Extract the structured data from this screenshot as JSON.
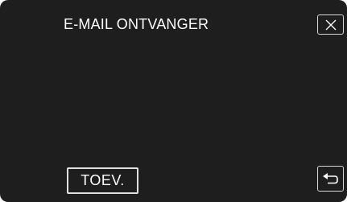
{
  "header": {
    "title": "E-MAIL ONTVANGER"
  },
  "actions": {
    "add_label": "TOEV."
  },
  "icons": {
    "close": "close-icon",
    "back": "back-arrow-icon"
  },
  "colors": {
    "background": "#1e1e1e",
    "text": "#ffffff",
    "border": "#d8d8d8"
  }
}
